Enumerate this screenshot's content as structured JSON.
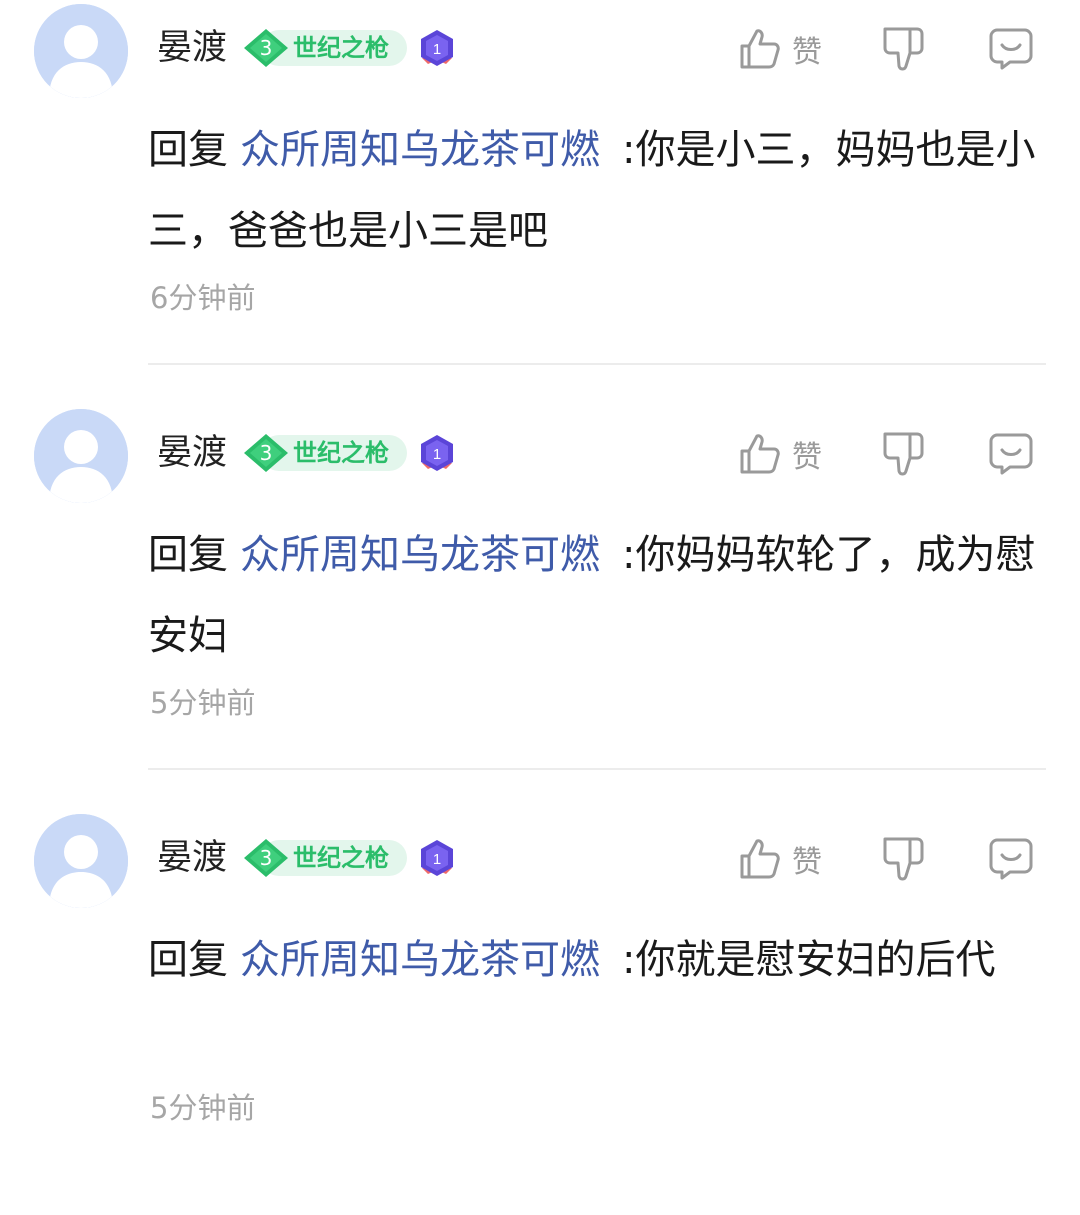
{
  "colors": {
    "mention": "#3f5ba9",
    "level_badge_green": "#2bbd6a",
    "timestamp_gray": "#a6a6a6",
    "icon_gray": "#9a9a9a",
    "avatar_blue": "#c9d9f7",
    "medal_purple": "#5b45d8"
  },
  "comments": [
    {
      "username": "晏渡",
      "level": "3",
      "level_title": "世纪之枪",
      "medal_number": "1",
      "like_label": "赞",
      "icons": [
        "thumbs-up-icon",
        "thumbs-down-icon",
        "reply-bubble-icon"
      ],
      "reply_prefix": "回复",
      "mention": "众所周知乌龙茶可燃",
      "text": ":你是小三，妈妈也是小三，爸爸也是小三是吧",
      "time": "6分钟前"
    },
    {
      "username": "晏渡",
      "level": "3",
      "level_title": "世纪之枪",
      "medal_number": "1",
      "like_label": "赞",
      "icons": [
        "thumbs-up-icon",
        "thumbs-down-icon",
        "reply-bubble-icon"
      ],
      "reply_prefix": "回复",
      "mention": "众所周知乌龙茶可燃",
      "text": ":你妈妈软轮了，成为慰安妇",
      "time": "5分钟前"
    },
    {
      "username": "晏渡",
      "level": "3",
      "level_title": "世纪之枪",
      "medal_number": "1",
      "like_label": "赞",
      "icons": [
        "thumbs-up-icon",
        "thumbs-down-icon",
        "reply-bubble-icon"
      ],
      "reply_prefix": "回复",
      "mention": "众所周知乌龙茶可燃",
      "text": ":你就是慰安妇的后代",
      "time": "5分钟前"
    }
  ]
}
